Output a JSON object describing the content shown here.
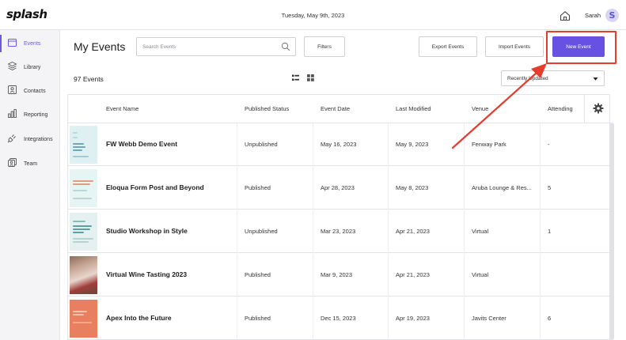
{
  "app": {
    "logo": "splash",
    "date": "Tuesday, May 9th, 2023",
    "user_name": "Sarah",
    "avatar_initial": "S"
  },
  "sidebar": {
    "items": [
      {
        "label": "Events",
        "icon": "calendar-icon",
        "active": true
      },
      {
        "label": "Library",
        "icon": "layers-icon",
        "active": false
      },
      {
        "label": "Contacts",
        "icon": "contact-card-icon",
        "active": false
      },
      {
        "label": "Reporting",
        "icon": "bar-chart-icon",
        "active": false
      },
      {
        "label": "Integrations",
        "icon": "plug-icon",
        "active": false
      },
      {
        "label": "Team",
        "icon": "team-icon",
        "active": false
      }
    ]
  },
  "header": {
    "title": "My Events",
    "search_placeholder": "Search Events",
    "filters_label": "Filters",
    "export_label": "Export Events",
    "import_label": "Import Events",
    "new_event_label": "New Event"
  },
  "list_controls": {
    "count_text": "97 Events",
    "sort_value": "Recently Updated"
  },
  "table": {
    "columns": [
      "Event Name",
      "Published Status",
      "Event Date",
      "Last Modified",
      "Venue",
      "Attending"
    ],
    "rows": [
      {
        "name": "FW Webb Demo Event",
        "status": "Unpublished",
        "event_date": "May 16, 2023",
        "modified": "May 9, 2023",
        "venue": "Fenway Park",
        "attending": "-"
      },
      {
        "name": "Eloqua Form Post and Beyond",
        "status": "Published",
        "event_date": "Apr 28, 2023",
        "modified": "May 8, 2023",
        "venue": "Aruba Lounge & Res...",
        "attending": "5"
      },
      {
        "name": "Studio Workshop in Style",
        "status": "Unpublished",
        "event_date": "Mar 23, 2023",
        "modified": "Apr 21, 2023",
        "venue": "Virtual",
        "attending": "1"
      },
      {
        "name": "Virtual Wine Tasting 2023",
        "status": "Published",
        "event_date": "Mar 9, 2023",
        "modified": "Apr 21, 2023",
        "venue": "Virtual",
        "attending": ""
      },
      {
        "name": "Apex Into the Future",
        "status": "Published",
        "event_date": "Dec 15, 2023",
        "modified": "Apr 19, 2023",
        "venue": "Javits Center",
        "attending": "6"
      }
    ]
  },
  "colors": {
    "accent": "#6651e3",
    "annotation": "#e53d2d"
  }
}
